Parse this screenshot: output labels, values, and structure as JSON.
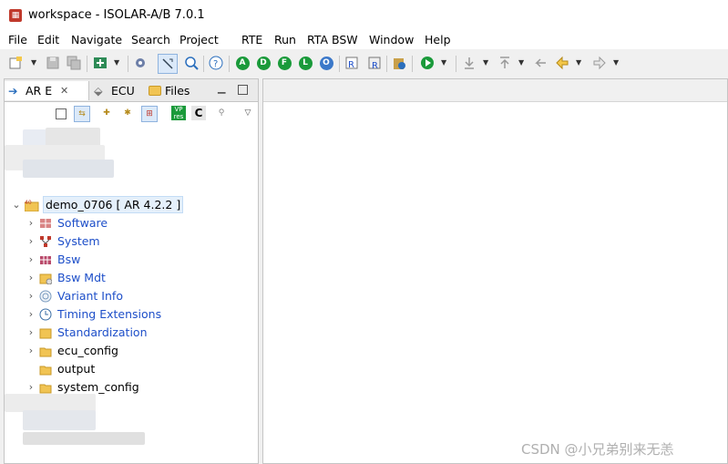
{
  "window": {
    "title": "workspace - ISOLAR-A/B 7.0.1"
  },
  "menubar": {
    "items": [
      "File",
      "Edit",
      "Navigate",
      "Search",
      "Project",
      "RTE",
      "Run",
      "RTA BSW",
      "Window",
      "Help"
    ]
  },
  "toolbar": {
    "run_buttons": [
      "A",
      "D",
      "F",
      "L",
      "O"
    ]
  },
  "left_panel": {
    "tabs": [
      "AR E",
      "ECU",
      "Files"
    ],
    "project": "demo_0706 [ AR 4.2.2 ]",
    "tree_items": [
      "Software",
      "System",
      "Bsw",
      "Bsw Mdt",
      "Variant Info",
      "Timing Extensions",
      "Standardization",
      "ecu_config",
      "output",
      "system_config"
    ]
  },
  "watermark": "CSDN @小兄弟别来无恙"
}
